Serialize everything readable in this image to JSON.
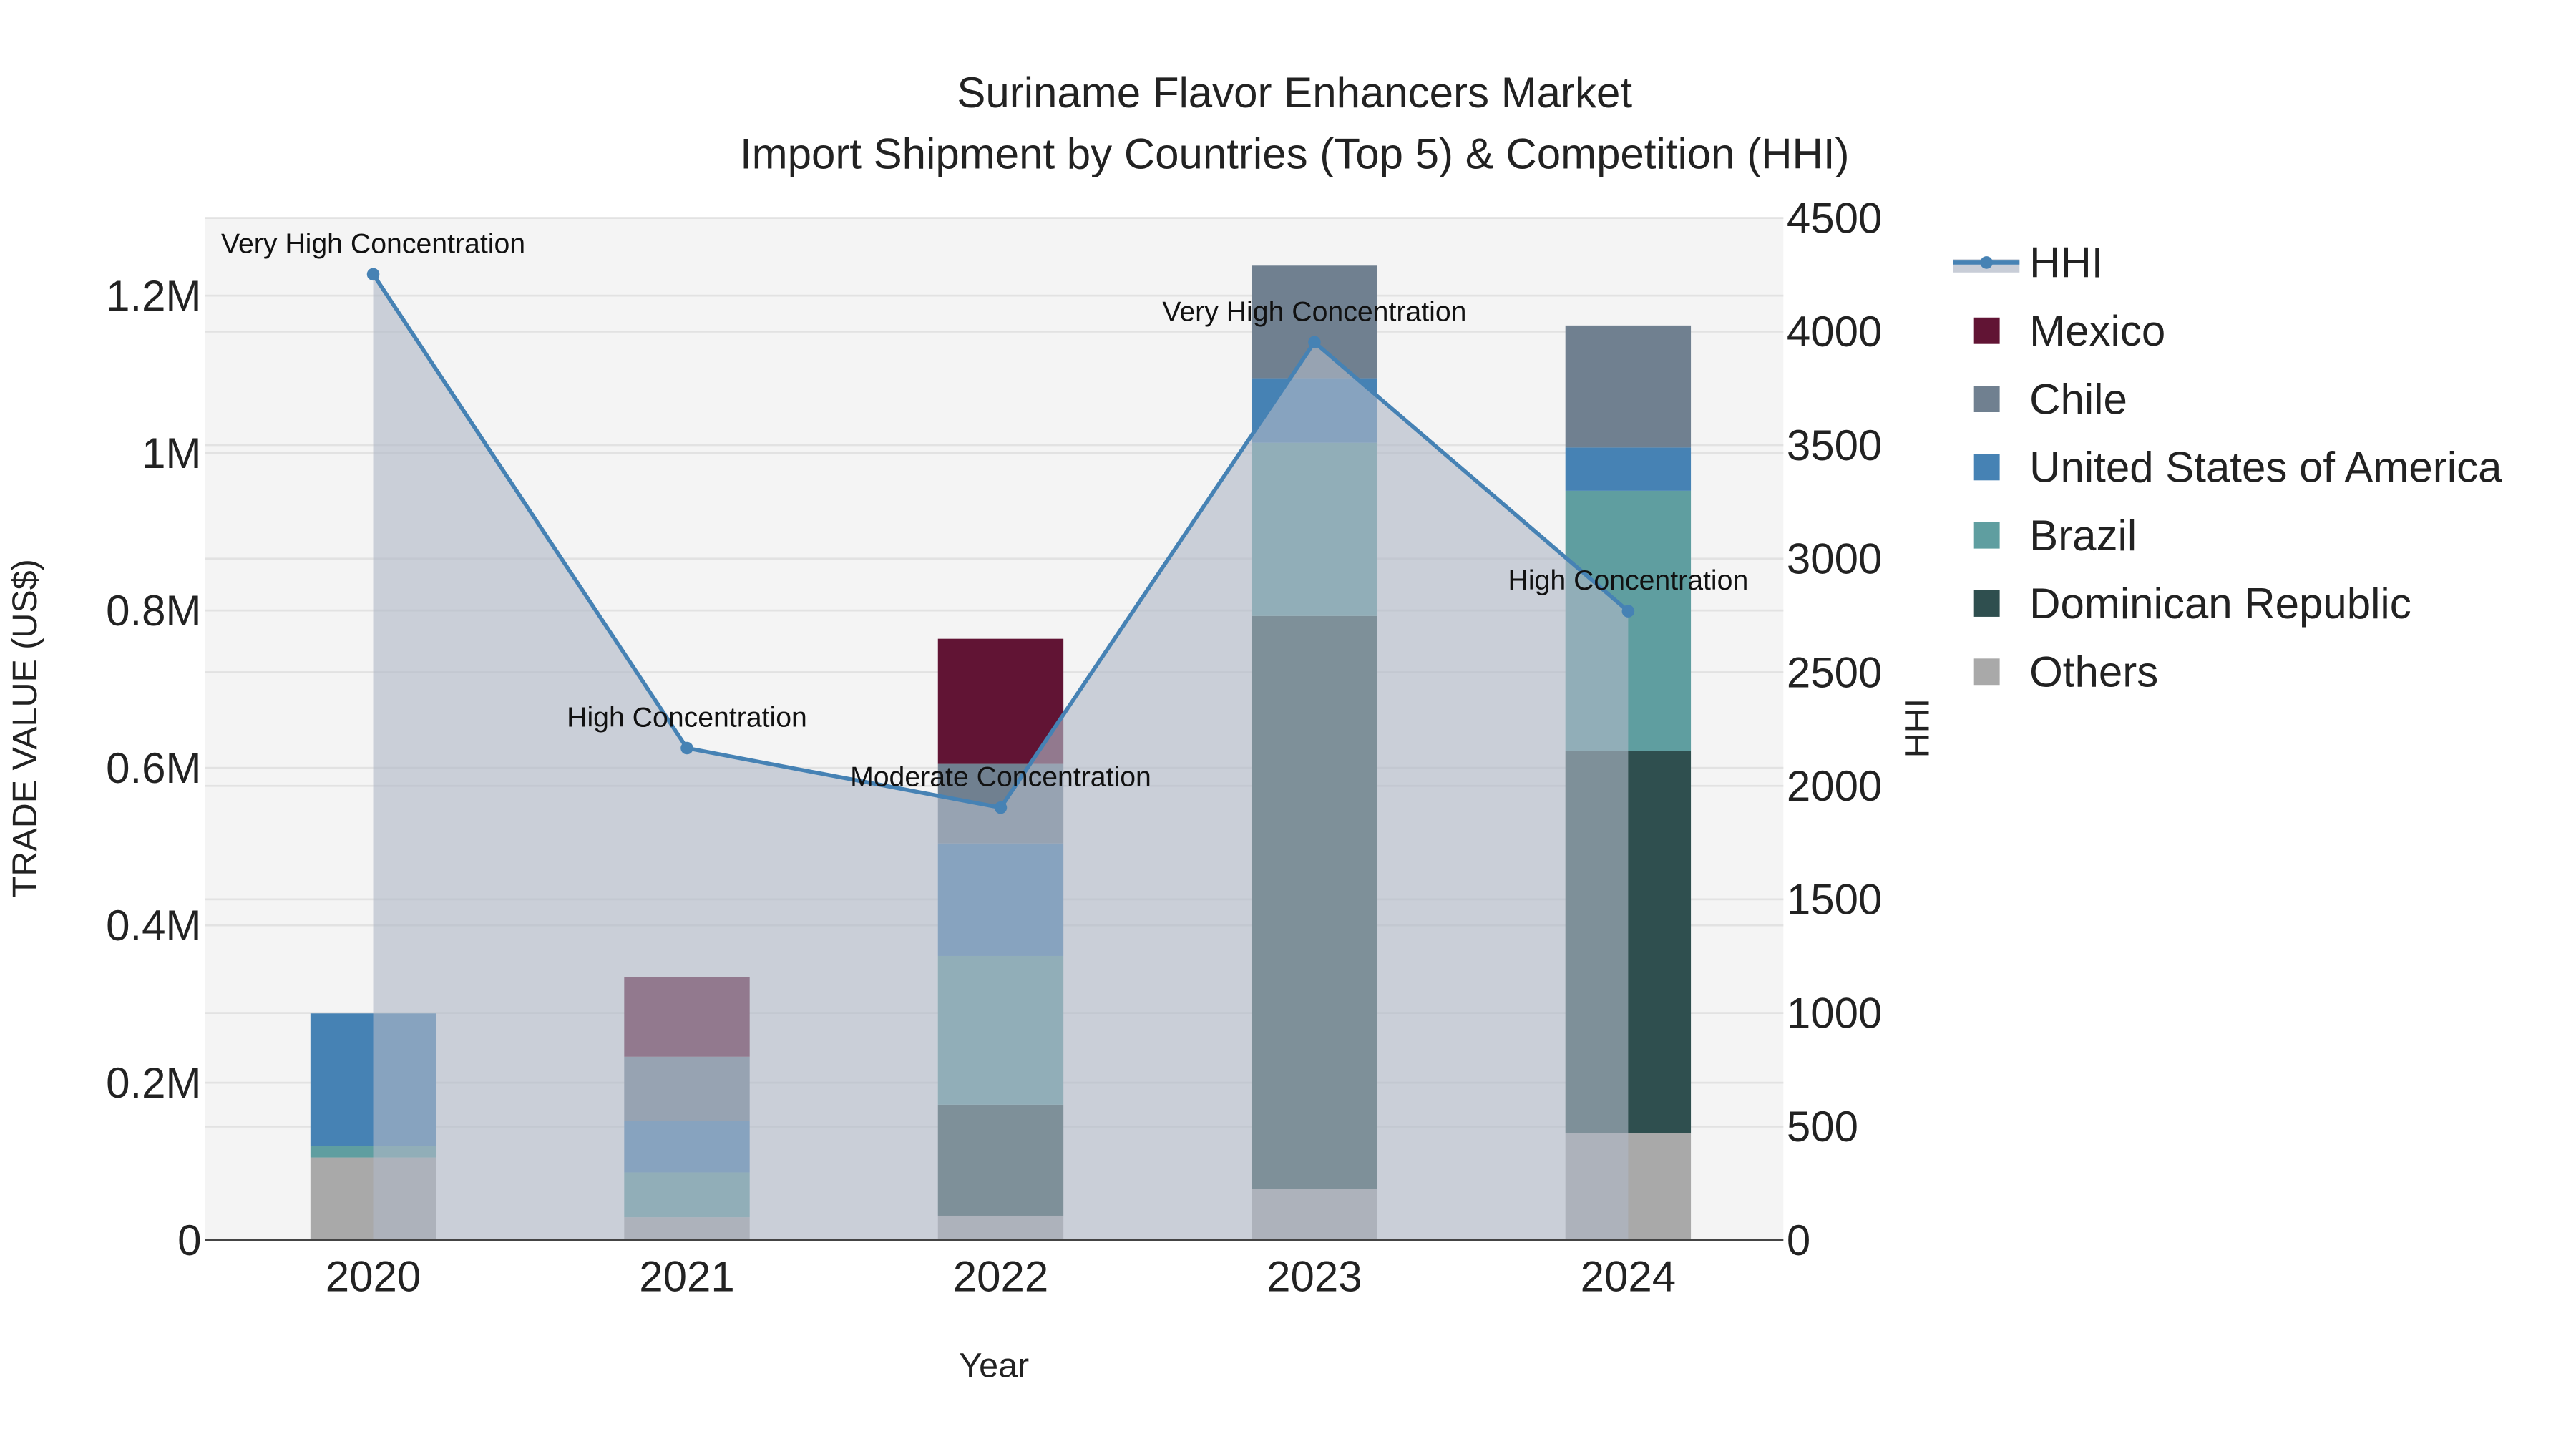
{
  "chart_data": {
    "type": "bar",
    "stacked": true,
    "title": "Suriname Flavor Enhancers Market",
    "subtitle": "Import Shipment by Countries (Top 5) & Competition (HHI)",
    "xlabel": "Year",
    "ylabel": "TRADE VALUE (US$)",
    "y2label": "HHI",
    "categories": [
      "2020",
      "2021",
      "2022",
      "2023",
      "2024"
    ],
    "ylim": [
      0,
      1300000
    ],
    "yticks": [
      0,
      200000,
      400000,
      600000,
      800000,
      1000000,
      1200000
    ],
    "ytick_labels": [
      "0",
      "0.2M",
      "0.4M",
      "0.6M",
      "0.8M",
      "1M",
      "1.2M"
    ],
    "y2lim": [
      0,
      4500
    ],
    "y2ticks": [
      0,
      500,
      1000,
      1500,
      2000,
      2500,
      3000,
      3500,
      4000,
      4500
    ],
    "y2tick_labels": [
      "0",
      "500",
      "1000",
      "1500",
      "2000",
      "2500",
      "3000",
      "3500",
      "4000",
      "4500"
    ],
    "grid": true,
    "legend_position": "right",
    "series": [
      {
        "name": "Others",
        "color": "#A9A9A9",
        "values": [
          105000,
          29000,
          31000,
          65000,
          136000
        ]
      },
      {
        "name": "Dominican Republic",
        "color": "#2F4F4F",
        "values": [
          0,
          0,
          141000,
          728000,
          485000
        ]
      },
      {
        "name": "Brazil",
        "color": "#5F9EA0",
        "values": [
          15000,
          57000,
          189000,
          220000,
          331000
        ]
      },
      {
        "name": "United States of America",
        "color": "#4682B4",
        "values": [
          168000,
          65000,
          143000,
          82000,
          55000
        ]
      },
      {
        "name": "Chile",
        "color": "#708090",
        "values": [
          0,
          82000,
          101000,
          143000,
          155000
        ]
      },
      {
        "name": "Mexico",
        "color": "#611434",
        "values": [
          0,
          101000,
          159000,
          0,
          0
        ]
      }
    ],
    "hhi": {
      "name": "HHI",
      "color": "#4682B4",
      "values": [
        4252,
        2166,
        1904,
        3953,
        2769
      ],
      "annotations": [
        "Very High Concentration",
        "High Concentration",
        "Moderate Concentration",
        "Very High Concentration",
        "High Concentration"
      ]
    },
    "legend_order": [
      "HHI",
      "Mexico",
      "Chile",
      "United States of America",
      "Brazil",
      "Dominican Republic",
      "Others"
    ]
  }
}
